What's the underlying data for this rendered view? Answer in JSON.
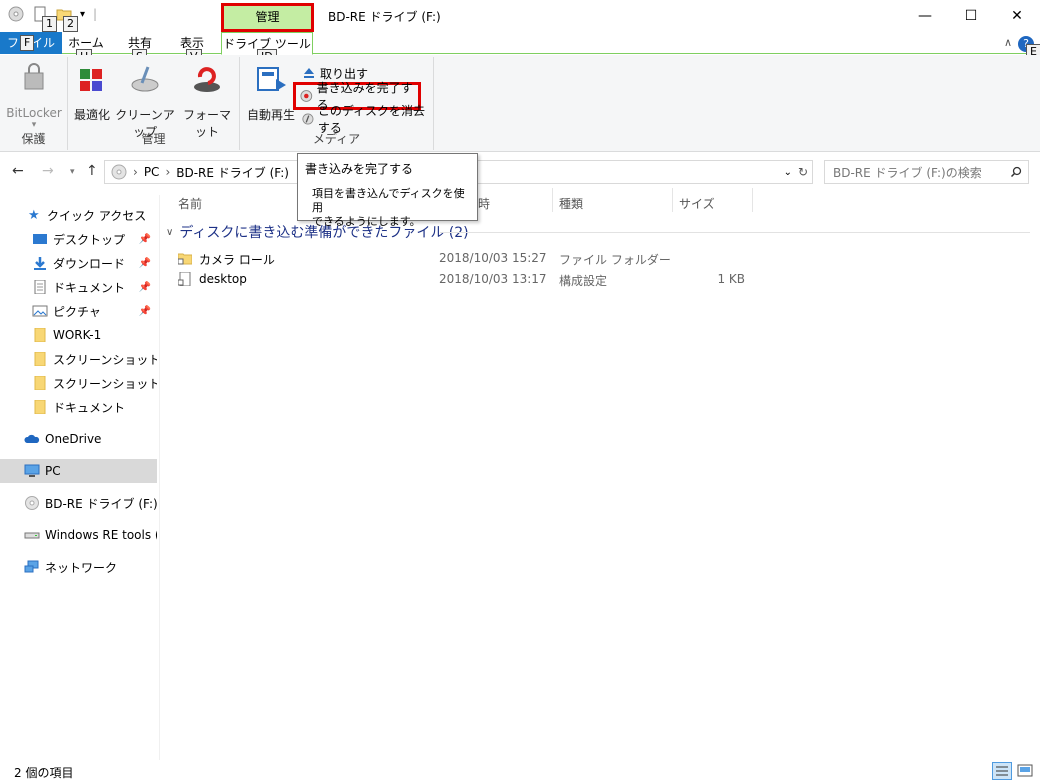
{
  "window": {
    "title": "BD-RE ドライブ (F:)",
    "context_tab": "管理",
    "min": "—",
    "max": "☐",
    "close": "✕"
  },
  "qat": {
    "keytip1": "1",
    "keytip2": "2"
  },
  "tabs": {
    "file": "ファイル",
    "file_key": "F",
    "home": "ホーム",
    "home_key": "H",
    "share": "共有",
    "share_key": "S",
    "view": "表示",
    "view_key": "V",
    "drive_tools": "ドライブ ツール",
    "drive_key": "JD",
    "help_key": "E"
  },
  "ribbon": {
    "bitlocker": "BitLocker",
    "group_protect": "保護",
    "optimize": "最適化",
    "cleanup": "クリーンアップ",
    "format": "フォーマット",
    "group_manage": "管理",
    "autoplay": "自動再生",
    "eject": "取り出す",
    "finish_burning": "書き込みを完了する",
    "erase_disc": "このディスクを消去する",
    "group_media": "メディア"
  },
  "tooltip": {
    "title": "書き込みを完了する",
    "body_line1": "項目を書き込んでディスクを使用",
    "body_line2": "できるようにします。"
  },
  "address": {
    "back": "←",
    "forward": "→",
    "up": "↑",
    "crumb_pc": "PC",
    "crumb_drive": "BD-RE ドライブ (F:)",
    "search_placeholder": "BD-RE ドライブ (F:)の検索"
  },
  "nav": {
    "quick_access": "クイック アクセス",
    "desktop": "デスクトップ",
    "downloads": "ダウンロード",
    "documents": "ドキュメント",
    "pictures": "ピクチャ",
    "work1": "WORK-1",
    "screenshots1": "スクリーンショット",
    "screenshots2": "スクリーンショット",
    "documents2": "ドキュメント",
    "onedrive": "OneDrive",
    "pc": "PC",
    "bdre": "BD-RE ドライブ (F:)",
    "winre": "Windows RE tools (E:",
    "network": "ネットワーク"
  },
  "columns": {
    "name": "名前",
    "date": "時",
    "type": "種類",
    "size": "サイズ"
  },
  "group_header": "ディスクに書き込む準備ができたファイル (2)",
  "files": [
    {
      "name": "カメラ ロール",
      "date": "2018/10/03 15:27",
      "type": "ファイル フォルダー",
      "size": ""
    },
    {
      "name": "desktop",
      "date": "2018/10/03 13:17",
      "type": "構成設定",
      "size": "1 KB"
    }
  ],
  "status": {
    "count": "2 個の項目"
  }
}
